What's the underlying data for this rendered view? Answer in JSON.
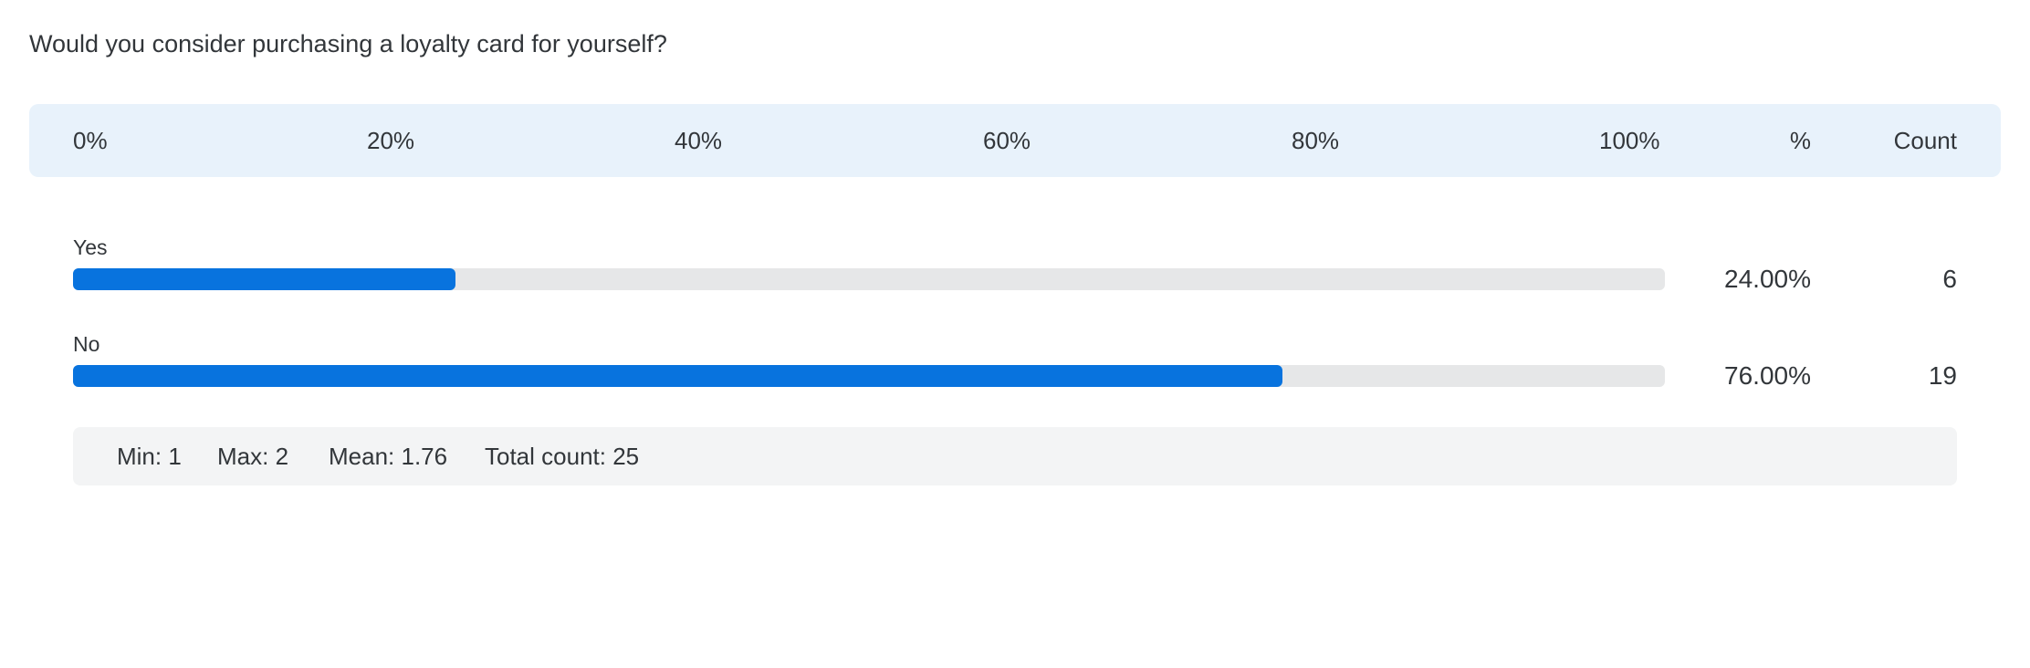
{
  "question": "Would you consider purchasing a loyalty card for yourself?",
  "header": {
    "ticks": [
      "0%",
      "20%",
      "40%",
      "60%",
      "80%",
      "100%"
    ],
    "percent_label": "%",
    "count_label": "Count"
  },
  "rows": [
    {
      "label": "Yes",
      "percent_text": "24.00%",
      "count_text": "6"
    },
    {
      "label": "No",
      "percent_text": "76.00%",
      "count_text": "19"
    }
  ],
  "stats": {
    "min": "Min: 1",
    "max": "Max: 2",
    "mean": "Mean: 1.76",
    "total": "Total count: 25"
  },
  "colors": {
    "bar_fill": "#0873de",
    "bar_track": "#e6e7e8",
    "header_bg": "#e8f2fb",
    "stats_bg": "#f3f4f5"
  },
  "chart_data": {
    "type": "bar",
    "orientation": "horizontal",
    "title": "Would you consider purchasing a loyalty card for yourself?",
    "categories": [
      "Yes",
      "No"
    ],
    "values": [
      24.0,
      76.0
    ],
    "counts": [
      6,
      19
    ],
    "xlim": [
      0,
      100
    ],
    "xticks": [
      "0%",
      "20%",
      "40%",
      "60%",
      "80%",
      "100%"
    ],
    "grid": false,
    "legend": "none"
  }
}
